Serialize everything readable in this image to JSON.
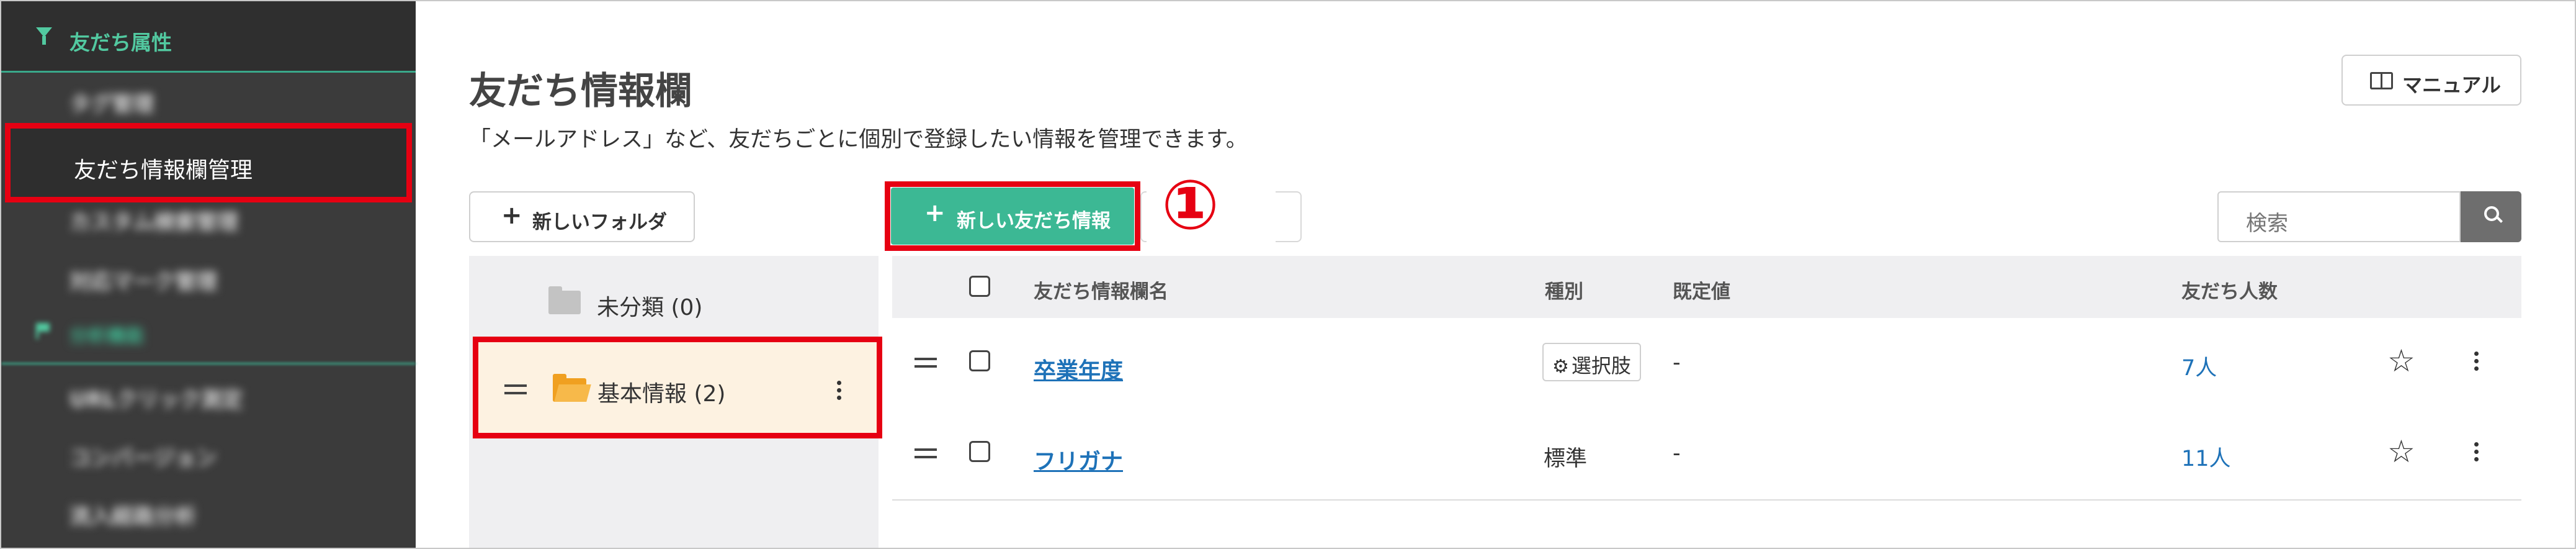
{
  "sidebar": {
    "section_label": "友だち属性",
    "items": [
      {
        "label": "タグ管理"
      },
      {
        "label": "友だち情報欄管理"
      },
      {
        "label": "カスタム検索管理"
      },
      {
        "label": "対応マーク管理"
      }
    ],
    "section2_label": "分析機能",
    "items2": [
      {
        "label": "URLクリック測定"
      },
      {
        "label": "コンバージョン"
      },
      {
        "label": "流入経路分析"
      }
    ]
  },
  "header": {
    "title": "友だち情報欄",
    "description": "「メールアドレス」など、友だちごとに個別で登録したい情報を管理できます。",
    "manual_label": "マニュアル"
  },
  "toolbar": {
    "new_folder_label": "新しいフォルダ",
    "new_info_label": "新しい友だち情報",
    "step_marker": "①",
    "search_placeholder": "検索"
  },
  "folders": [
    {
      "name": "未分類 (0)"
    },
    {
      "name": "基本情報 (2)"
    }
  ],
  "table": {
    "columns": {
      "name": "友だち情報欄名",
      "type": "種別",
      "default": "既定値",
      "count": "友だち人数"
    },
    "rows": [
      {
        "name": "卒業年度",
        "type": "選択肢",
        "default": "-",
        "count": "7人"
      },
      {
        "name": "フリガナ",
        "type": "標準",
        "default": "-",
        "count": "11人"
      }
    ]
  },
  "colors": {
    "accent_green": "#3cb894",
    "highlight_red": "#e60012",
    "link_blue": "#1e72b8",
    "sidebar_bg": "#3b3b3b"
  }
}
